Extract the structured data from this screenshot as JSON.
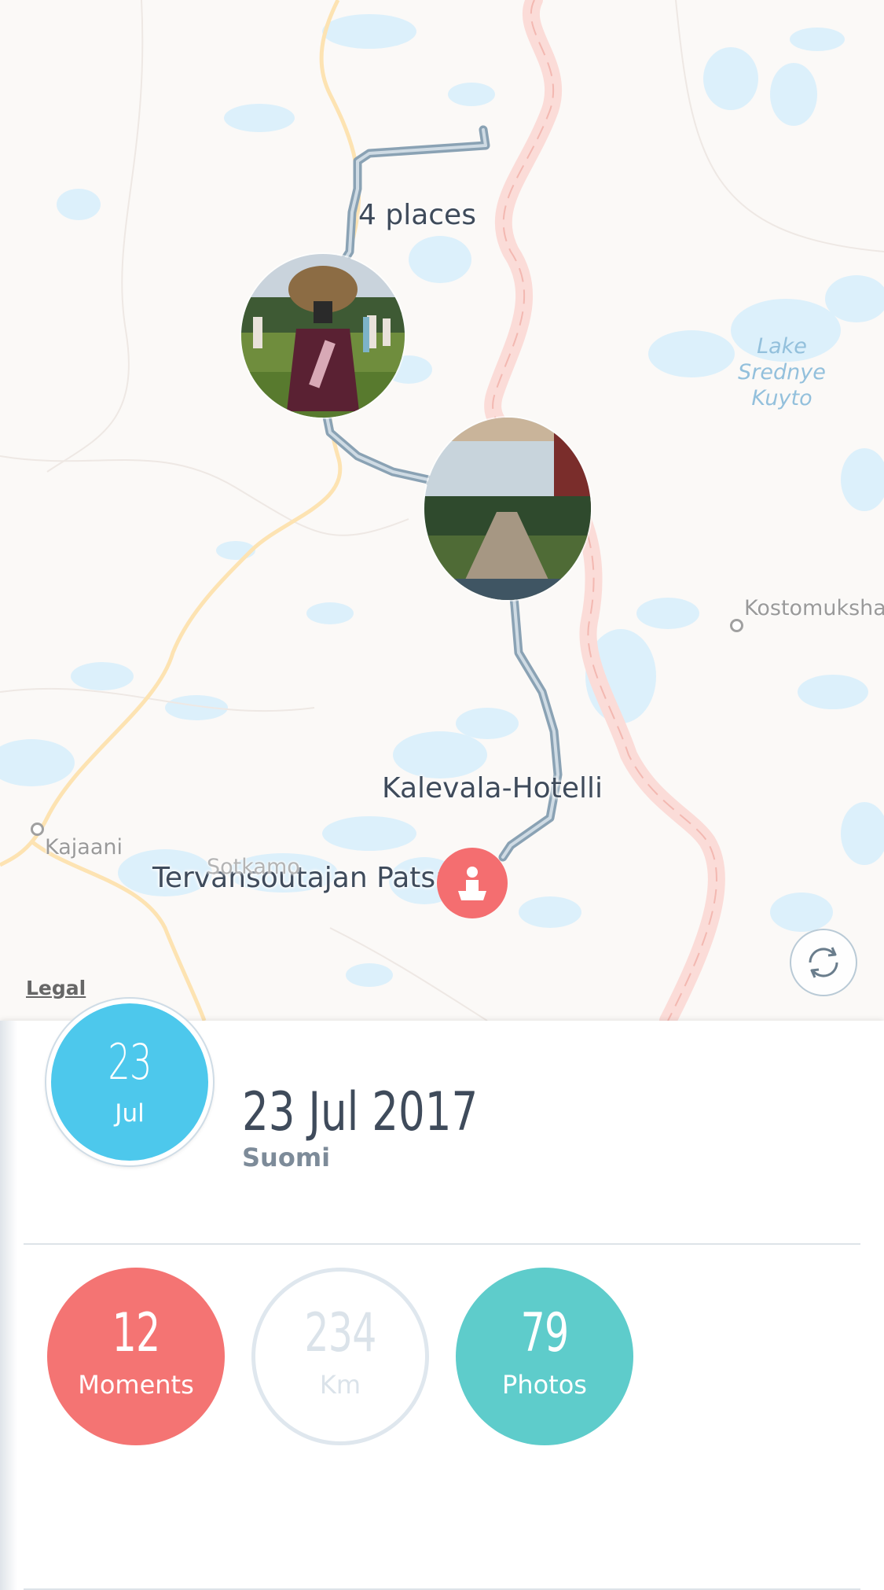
{
  "map": {
    "route_label": "4 places",
    "places": [
      "Kalevala-Hotelli",
      "Tervansoutajan Patsas"
    ],
    "cities": [
      "Kostomukshа",
      "Kajaani",
      "Sotkamo"
    ],
    "lake_label": [
      "Lake",
      "Srednye",
      "Kuyto"
    ],
    "legal": "Legal",
    "recenter_icon": "refresh-icon",
    "pin_icon": "statue-icon"
  },
  "day": {
    "day": "23",
    "month": "Jul",
    "full_date": "23 Jul 2017",
    "country": "Suomi"
  },
  "stats": [
    {
      "value": "12",
      "label": "Moments",
      "color": "#f47473"
    },
    {
      "value": "234",
      "label": "Km",
      "color": "#dfe7ee"
    },
    {
      "value": "79",
      "label": "Photos",
      "color": "#5ecccb"
    }
  ],
  "colors": {
    "accent_blue": "#4dc8ec",
    "route": "#6f8a9e",
    "border_road": "#f9d3cf",
    "water": "#d9eefb"
  }
}
